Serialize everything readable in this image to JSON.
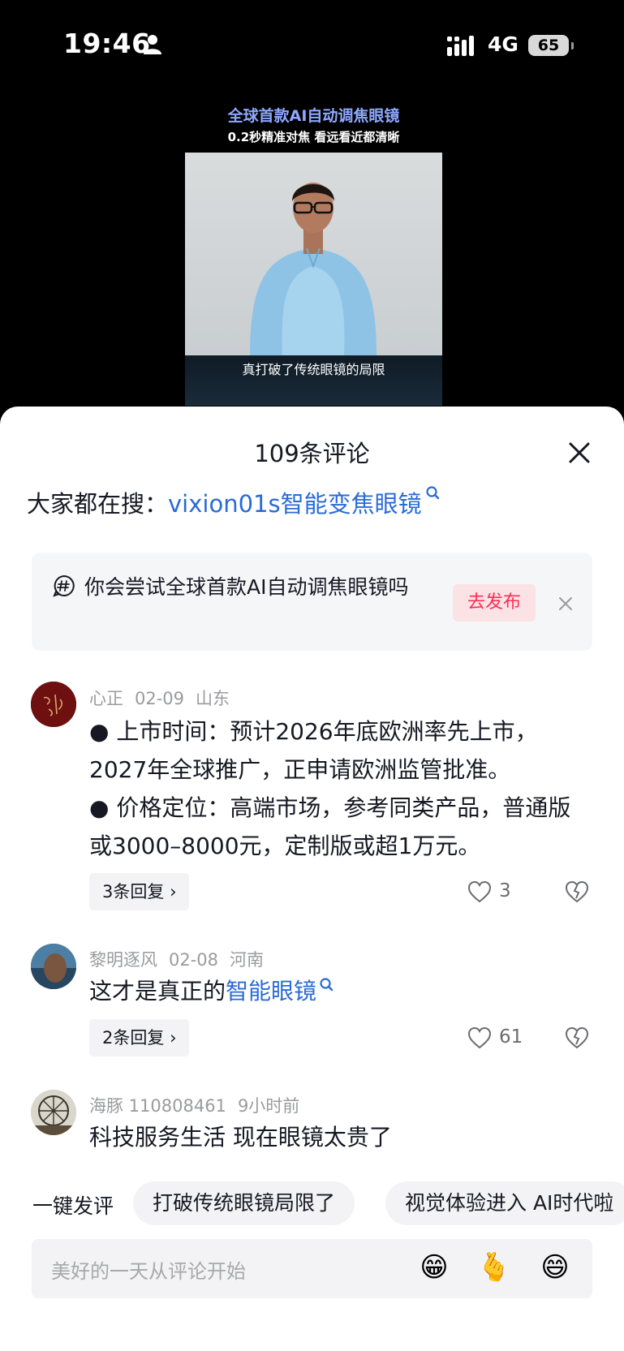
{
  "status_bar": {
    "time": "19:46",
    "network": "4G",
    "battery": "65"
  },
  "video": {
    "headline": "全球首款AI自动调焦眼镜",
    "subheadline": "0.2秒精准对焦 看远看近都清晰",
    "caption": "真打破了传统眼镜的局限"
  },
  "sheet": {
    "title": "109条评论"
  },
  "search": {
    "prefix": "大家都在搜：",
    "query": "vixion01s智能变焦眼镜"
  },
  "topic": {
    "prompt": "你会尝试全球首款AI自动调焦眼镜吗",
    "publish_label": "去发布"
  },
  "comments": [
    {
      "user": "心正",
      "date": "02-09",
      "location": "山东",
      "lines": [
        "● 上市时间：预计2026年底欧洲率先上市，2027年全球推广，正申请欧洲监管批准。",
        "● 价格定位：高端市场，参考同类产品，普通版或3000–8000元，定制版或超1万元。"
      ],
      "replies": "3条回复",
      "likes": "3"
    },
    {
      "user": "黎明逐风",
      "date": "02-08",
      "location": "河南",
      "text_prefix": "这才是真正的",
      "text_link": "智能眼镜",
      "replies": "2条回复",
      "likes": "61"
    },
    {
      "user": "海豚 110808461",
      "date": "9小时前",
      "text": "科技服务生活 现在眼镜太贵了"
    }
  ],
  "quick_reply": {
    "label": "一键发评",
    "chips": [
      "打破传统眼镜局限了",
      "视觉体验进入 AI时代啦"
    ]
  },
  "input": {
    "placeholder": "美好的一天从评论开始",
    "emojis": [
      "😁",
      "🫰",
      "😄"
    ]
  }
}
